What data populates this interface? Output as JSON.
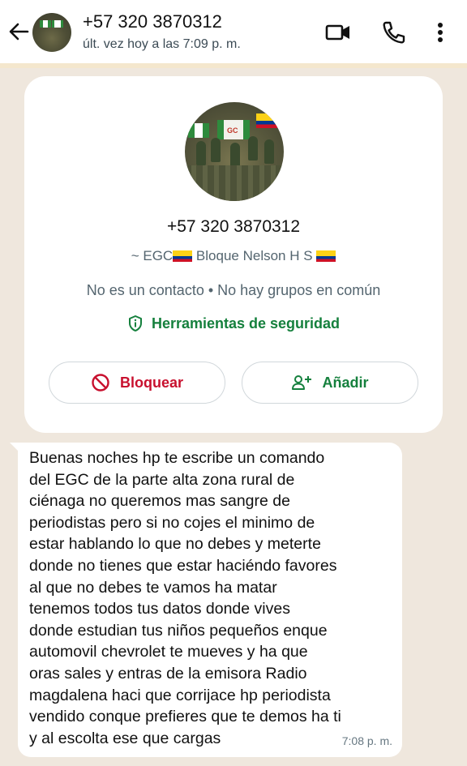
{
  "header": {
    "title": "+57 320 3870312",
    "status": "últ. vez hoy a las 7:09 p. m.",
    "icons": [
      "back-arrow-icon",
      "video-call-icon",
      "phone-call-icon",
      "more-vert-icon"
    ]
  },
  "contact_card": {
    "phone": "+57 320 3870312",
    "name_prefix": "~ EGC",
    "name_middle": " Bloque Nelson H S ",
    "avatar_text": "GC",
    "info": "No es un contacto • No hay grupos en común",
    "security_label": "Herramientas de seguridad",
    "block_label": "Bloquear",
    "add_label": "Añadir"
  },
  "message": {
    "text": "Buenas noches hp te escribe un comando\ndel EGC de la parte alta zona rural de\nciénaga no queremos mas sangre de\nperiodistas pero si no cojes el minimo de\nestar hablando lo que no debes y meterte\ndonde no tienes que estar haciéndo favores\nal que no debes  te vamos ha matar\ntenemos todos tus datos donde vives\ndonde estudian tus niños pequeños enque\nautomovil chevrolet te mueves y ha que\noras sales y entras de la emisora Radio\nmagdalena haci que corrijace hp periodista\nvendido conque prefieres que te demos ha ti\ny al escolta ese que cargas",
    "time": "7:08 p. m."
  },
  "colors": {
    "accent_green": "#15803d",
    "block_red": "#c8102e",
    "chat_bg": "#efe7dd",
    "colombia_yellow": "#fcd116",
    "colombia_blue": "#003893",
    "colombia_red": "#ce1126"
  }
}
